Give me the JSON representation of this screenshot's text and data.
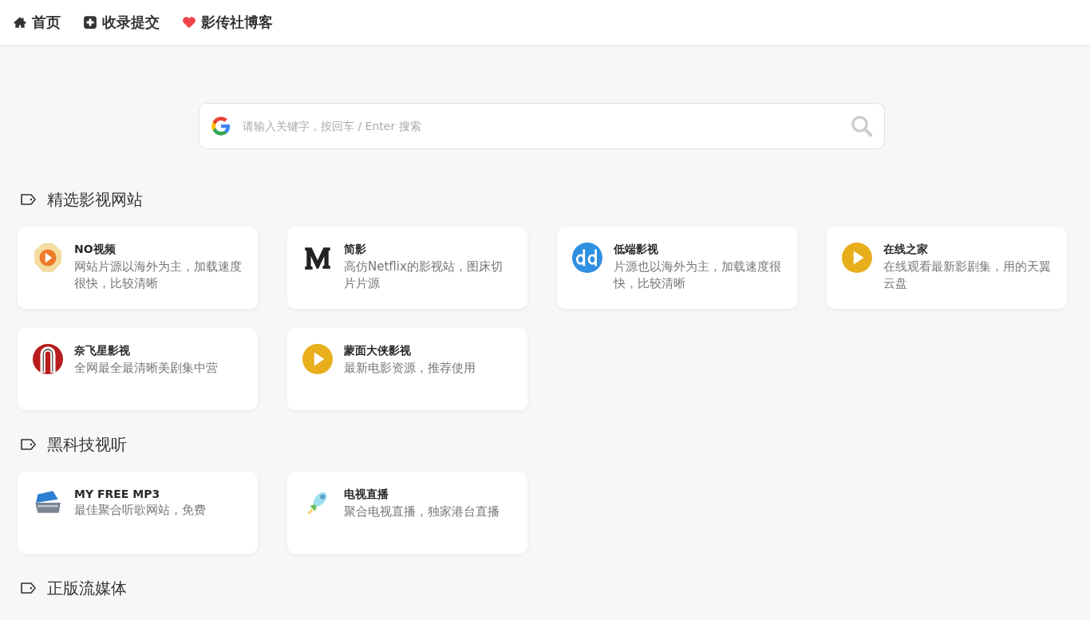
{
  "nav": [
    {
      "kind": "home",
      "label": "首页"
    },
    {
      "kind": "plus-square",
      "label": "收录提交"
    },
    {
      "kind": "heart",
      "label": "影传社博客"
    }
  ],
  "search": {
    "placeholder": "请输入关键字，按回车 / Enter 搜索"
  },
  "sections": [
    {
      "title": "精选影视网站",
      "cards": [
        {
          "kind": "octagon-play",
          "title": "NO视频",
          "desc": "网站片源以海外为主，加载速度很快，比较清晰"
        },
        {
          "kind": "m-letter",
          "title": "简影",
          "desc": "高仿Netflix的影视站，图床切片片源"
        },
        {
          "kind": "dd-letters",
          "title": "低端影视",
          "desc": "片源也以海外为主，加载速度很快，比较清晰"
        },
        {
          "kind": "play-circle",
          "title": "在线之家",
          "desc": "在线观看最新影剧集，用的天翼云盘"
        },
        {
          "kind": "n-circle",
          "title": "奈飞星影视",
          "desc": "全网最全最清晰美剧集中营"
        },
        {
          "kind": "play-circle",
          "title": "蒙面大侠影视",
          "desc": "最新电影资源，推荐使用"
        }
      ]
    },
    {
      "title": "黑科技视听",
      "cards": [
        {
          "kind": "box",
          "title": "MY FREE MP3",
          "desc": "最佳聚合听歌网站，免费"
        },
        {
          "kind": "rocket",
          "title": "电视直播",
          "desc": "聚合电视直播，独家港台直播"
        }
      ]
    },
    {
      "title": "正版流媒体"
    }
  ]
}
